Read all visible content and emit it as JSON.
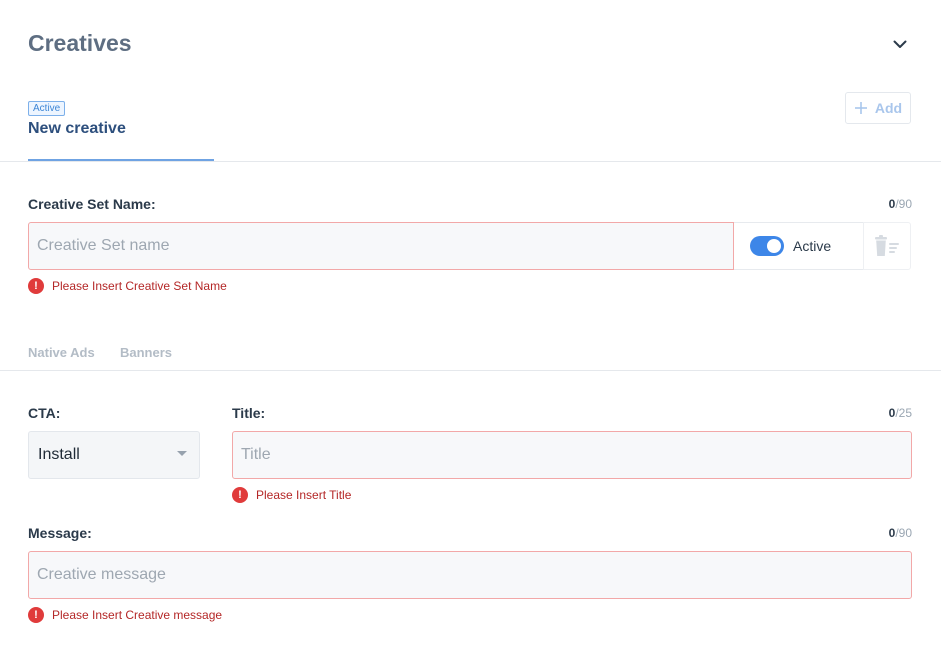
{
  "header": {
    "title": "Creatives"
  },
  "creative_tab": {
    "badge": "Active",
    "name": "New creative"
  },
  "add_button": {
    "label": "Add"
  },
  "creative_set": {
    "label": "Creative Set Name:",
    "counter_current": "0",
    "counter_max": "/90",
    "placeholder": "Creative Set name",
    "value": "",
    "toggle_label": "Active",
    "toggle_on": true,
    "error": "Please Insert Creative Set Name"
  },
  "ad_tabs": [
    "Native Ads",
    "Banners"
  ],
  "cta": {
    "label": "CTA:",
    "value": "Install"
  },
  "title_field": {
    "label": "Title:",
    "counter_current": "0",
    "counter_max": "/25",
    "placeholder": "Title",
    "value": "",
    "error": "Please Insert Title"
  },
  "message_field": {
    "label": "Message:",
    "counter_current": "0",
    "counter_max": "/90",
    "placeholder": "Creative message",
    "value": "",
    "error": "Please Insert Creative message"
  },
  "icons": {
    "collapse": "chevron-down-icon",
    "add": "plus-icon",
    "delete": "trash-icon",
    "error": "exclamation-icon"
  },
  "colors": {
    "accent": "#3d86e8",
    "error": "#e03b3b",
    "error_text": "#b42727",
    "error_border": "#f2a8a8",
    "title": "#5e6e82"
  }
}
